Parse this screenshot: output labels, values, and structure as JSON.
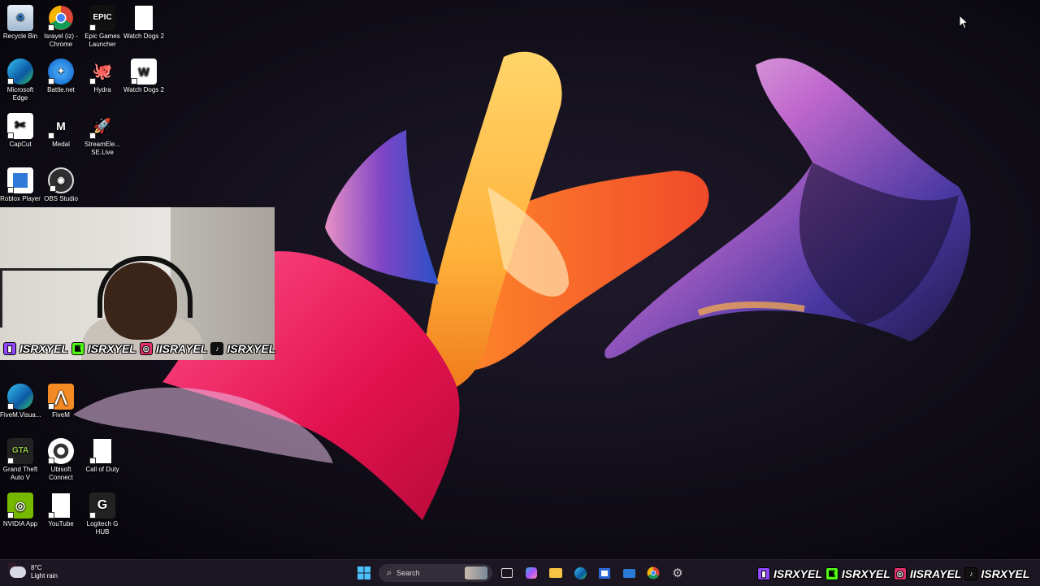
{
  "desktop": {
    "icons": [
      {
        "label": "Recycle Bin",
        "icon": "recycle-bin-icon"
      },
      {
        "label": "Israyel (iz) - Chrome",
        "icon": "chrome-icon"
      },
      {
        "label": "Epic Games Launcher",
        "icon": "epic-games-icon",
        "glyph": "EPIC"
      },
      {
        "label": "Watch Dogs 2",
        "icon": "file-icon"
      },
      {
        "label": "Microsoft Edge",
        "icon": "edge-icon"
      },
      {
        "label": "Battle.net",
        "icon": "battlenet-icon"
      },
      {
        "label": "Hydra",
        "icon": "hydra-icon"
      },
      {
        "label": "Watch Dogs 2",
        "icon": "watch-dogs-icon"
      },
      {
        "label": "CapCut",
        "icon": "capcut-icon"
      },
      {
        "label": "Medal",
        "icon": "medal-icon"
      },
      {
        "label": "StreamEle... SE.Live",
        "icon": "streamelements-icon"
      },
      {
        "label": "Roblox Player",
        "icon": "roblox-icon"
      },
      {
        "label": "OBS Studio",
        "icon": "obs-icon"
      },
      {
        "label": "FiveM.Visua...",
        "icon": "edge-icon"
      },
      {
        "label": "FiveM",
        "icon": "fivem-icon"
      },
      {
        "label": "Grand Theft Auto V",
        "icon": "gta-icon"
      },
      {
        "label": "Ubisoft Connect",
        "icon": "ubisoft-icon"
      },
      {
        "label": "Call of Duty",
        "icon": "file-icon"
      },
      {
        "label": "NVIDIA App",
        "icon": "nvidia-icon"
      },
      {
        "label": "YouTube",
        "icon": "file-icon"
      },
      {
        "label": "Logitech G HUB",
        "icon": "logitech-icon"
      }
    ]
  },
  "webcam": {
    "handles": [
      {
        "platform": "twitch",
        "icon": "twitch-icon",
        "text": "ISRXYEL"
      },
      {
        "platform": "kick",
        "icon": "kick-icon",
        "text": "ISRXYEL"
      },
      {
        "platform": "instagram",
        "icon": "instagram-icon",
        "text": "IISRAYEL"
      },
      {
        "platform": "tiktok",
        "icon": "tiktok-icon",
        "text": "ISRXYEL"
      }
    ]
  },
  "taskbar": {
    "weather": {
      "temp": "8°C",
      "condition": "Light rain"
    },
    "search": {
      "placeholder": "Search"
    },
    "apps": [
      "start-icon",
      "task-view-icon",
      "copilot-icon",
      "file-explorer-icon",
      "edge-icon",
      "store-icon",
      "mail-icon",
      "chrome-icon",
      "settings-icon"
    ],
    "social": [
      {
        "icon": "twitch-icon",
        "text": "ISRXYEL"
      },
      {
        "icon": "kick-icon",
        "text": "ISRXYEL"
      },
      {
        "icon": "instagram-icon",
        "text": "IISRAYEL"
      },
      {
        "icon": "tiktok-icon",
        "text": "ISRXYEL"
      }
    ]
  },
  "colors": {
    "twitch": "#9146ff",
    "kick": "#53fc18",
    "instagram": "#e1306c",
    "tiktok": "#111111"
  }
}
